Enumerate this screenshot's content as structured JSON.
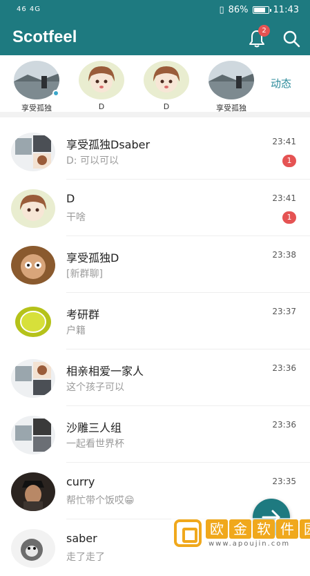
{
  "status_bar": {
    "signal_text": "46 4G",
    "battery": "86%",
    "time": "11:43"
  },
  "app_bar": {
    "title": "Scotfeel",
    "notification_count": "2"
  },
  "stories": {
    "items": [
      {
        "name": "享受孤独"
      },
      {
        "name": "D"
      },
      {
        "name": "D"
      },
      {
        "name": "享受孤独"
      }
    ],
    "dynamic_label": "动态"
  },
  "chats": [
    {
      "name": "享受孤独Dsaber",
      "message": "D:  可以可以",
      "time": "23:41",
      "unread": "1"
    },
    {
      "name": "D",
      "message": "干啥",
      "time": "23:41",
      "unread": "1"
    },
    {
      "name": "享受孤独D",
      "message": "[新群聊]",
      "time": "23:38"
    },
    {
      "name": "考研群",
      "message": "户籍",
      "time": "23:37"
    },
    {
      "name": "相亲相爱一家人",
      "message": "这个孩子可以",
      "time": "23:36"
    },
    {
      "name": "沙雕三人组",
      "message": "一起看世界杯",
      "time": "23:36"
    },
    {
      "name": "curry",
      "message": "帮忙带个饭哎😁",
      "time": "23:35"
    },
    {
      "name": "saber",
      "message": "走了走了",
      "time": ""
    }
  ],
  "watermark": {
    "chars": [
      "欧",
      "金",
      "软",
      "件",
      "园"
    ],
    "url": "www.apoujin.com"
  },
  "colors": {
    "primary": "#1e7a80",
    "badge": "#e55353",
    "accent_text": "#2a8a9a"
  }
}
